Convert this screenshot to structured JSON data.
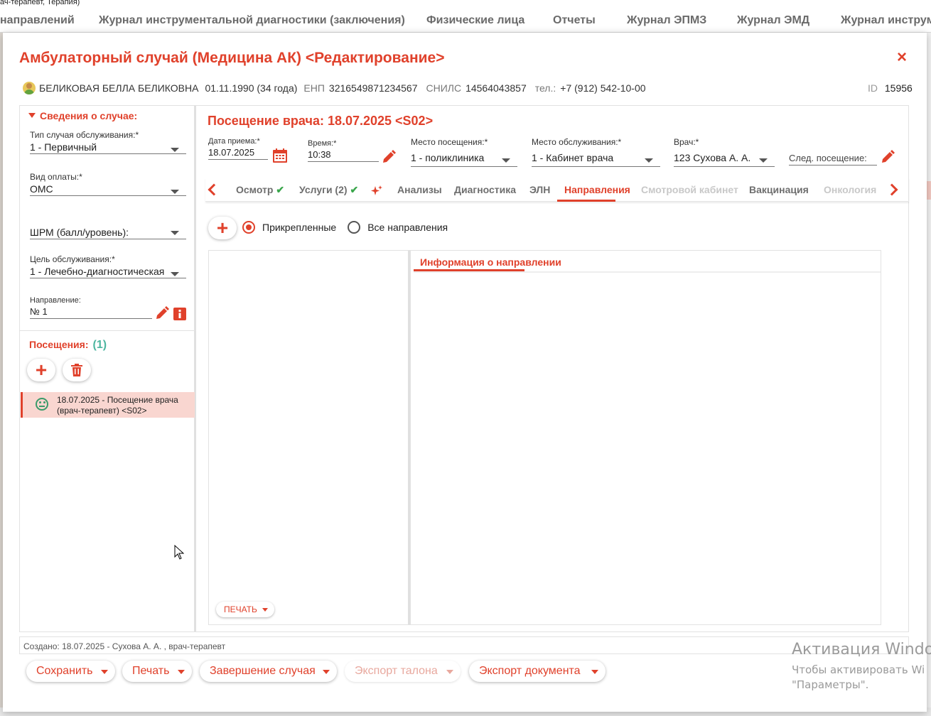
{
  "background": {
    "crumb": "ач-терапевт, Терапия)",
    "nav": [
      "направлений",
      "Журнал инструментальной диагностики (заключения)",
      "Физические лица",
      "Отчеты",
      "Журнал ЭПМЗ",
      "Журнал ЭМД",
      "Журнал инструм"
    ]
  },
  "modal": {
    "title": "Амбулаторный случай (Медицина АК) <Редактирование>",
    "close_glyph": "×"
  },
  "patient": {
    "name": "БЕЛИКОВАЯ БЕЛЛА БЕЛИКОВНА",
    "dob": "01.11.1990 (34 года)",
    "enp_label": "ЕНП",
    "enp_value": "3216549871234567",
    "snils_label": "СНИЛС",
    "snils_value": "14564043857",
    "tel_label": "тел.:",
    "tel_value": "+7 (912) 542-10-00",
    "id_label": "ID",
    "id_value": "15956"
  },
  "case_info": {
    "header": "Сведения о случае:",
    "service_type": {
      "label": "Тип случая обслуживания:*",
      "value": "1 - Первичный"
    },
    "payment": {
      "label": "Вид оплаты:*",
      "value": "ОМС"
    },
    "shrm": {
      "label": "",
      "value": "ШРМ (балл/уровень):"
    },
    "goal": {
      "label": "Цель обслуживания:*",
      "value": "1 - Лечебно-диагностическая"
    },
    "referral": {
      "label": "Направление:",
      "value": "№ 1"
    }
  },
  "visits": {
    "header": "Посещения:",
    "count": "(1)",
    "items": [
      {
        "text": "18.07.2025 - Посещение врача (врач-терапевт) <S02>"
      }
    ]
  },
  "visit": {
    "title": "Посещение врача: 18.07.2025 <S02>",
    "date": {
      "label": "Дата приема:*",
      "value": "18.07.2025"
    },
    "time": {
      "label": "Время:*",
      "value": "10:38"
    },
    "place": {
      "label": "Место посещения:*",
      "value": "1 - поликлиника"
    },
    "service_place": {
      "label": "Место обслуживания:*",
      "value": "1 - Кабинет врача"
    },
    "doctor": {
      "label": "Врач:*",
      "value": "123 Сухова А. А."
    },
    "next_visit": {
      "label": "",
      "value": "След. посещение:"
    }
  },
  "tabs": [
    {
      "label": "Осмотр",
      "state": "normal",
      "check": "✔"
    },
    {
      "label": "Услуги (2)",
      "state": "normal",
      "check": "✔"
    },
    {
      "label": "Анализы",
      "state": "normal"
    },
    {
      "label": "Диагностика",
      "state": "normal"
    },
    {
      "label": "ЭЛН",
      "state": "normal"
    },
    {
      "label": "Направления",
      "state": "active"
    },
    {
      "label": "Смотровой кабинет",
      "state": "disabled"
    },
    {
      "label": "Вакцинация",
      "state": "normal"
    },
    {
      "label": "Онкология",
      "state": "disabled"
    }
  ],
  "referrals": {
    "filter_attached": "Прикрепленные",
    "filter_all": "Все направления",
    "info_tab": "Информация о направлении",
    "print_label": "ПЕЧАТЬ"
  },
  "footer": {
    "created": "Создано: 18.07.2025 - Сухова А. А. , врач-терапевт",
    "buttons": {
      "save": "Сохранить",
      "print": "Печать",
      "finish": "Завершение случая",
      "export_coupon": "Экспорт талона",
      "export_doc": "Экспорт документа"
    }
  },
  "watermark": {
    "line1": "Активация Windo",
    "line2": "Чтобы активировать Wi",
    "line3": "\"Параметры\"."
  },
  "colors": {
    "accent": "#e0412b",
    "count_teal": "#4db6a0",
    "selected_row": "#f9d6d0",
    "disabled_tab": "#c8c8c8"
  },
  "icons": [
    "plus-icon",
    "trash-icon",
    "calendar-icon",
    "pencil-icon",
    "info-icon",
    "check-icon",
    "sparkle-icon",
    "smiley-icon",
    "chevron-left-icon",
    "chevron-right-icon",
    "caret-down-icon",
    "avatar-icon",
    "close-icon"
  ]
}
